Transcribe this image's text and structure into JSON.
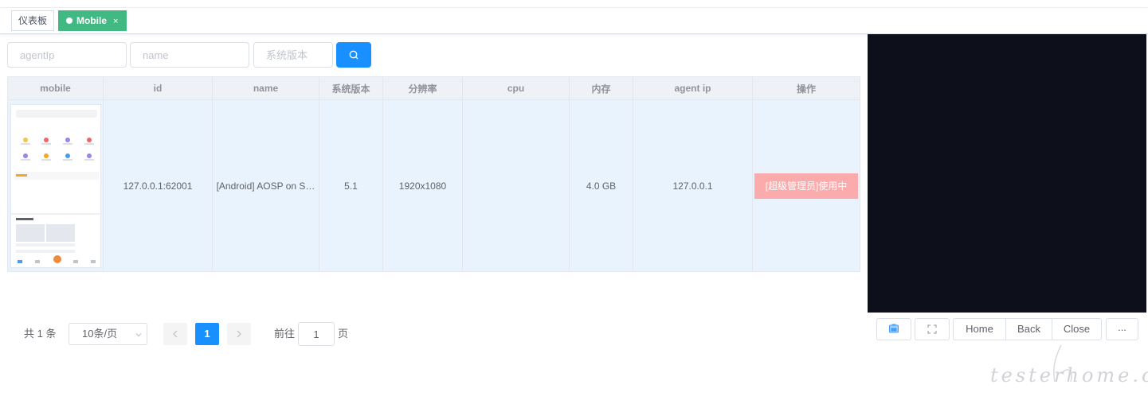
{
  "tags": [
    {
      "label": "仪表板"
    },
    {
      "label": "Mobile",
      "close": "×"
    }
  ],
  "filters": {
    "agentip_placeholder": "agentIp",
    "name_placeholder": "name",
    "version_placeholder": "系统版本"
  },
  "table": {
    "columns": [
      "mobile",
      "id",
      "name",
      "系统版本",
      "分辨率",
      "cpu",
      "内存",
      "agent ip",
      "操作"
    ],
    "rows": [
      {
        "id": "127.0.0.1:62001",
        "name": "[Android] AOSP on S…",
        "version": "5.1",
        "resolution": "1920x1080",
        "cpu": "",
        "memory": "4.0 GB",
        "agent_ip": "127.0.0.1",
        "action": "[超级管理员]使用中"
      }
    ]
  },
  "pagination": {
    "total": "共 1 条",
    "page_size": "10条/页",
    "current": "1",
    "goto_label": "前往",
    "goto_value": "1",
    "page_suffix": "页"
  },
  "device_controls": {
    "home": "Home",
    "back": "Back",
    "close": "Close",
    "more": "..."
  },
  "watermark": "testerhome.com",
  "colors": {
    "primary": "#1890ff",
    "tag_active": "#42b983",
    "owner_button": "#fbabab",
    "row_highlight": "#e8f3fe",
    "screen_bg": "#0d0f1a"
  }
}
